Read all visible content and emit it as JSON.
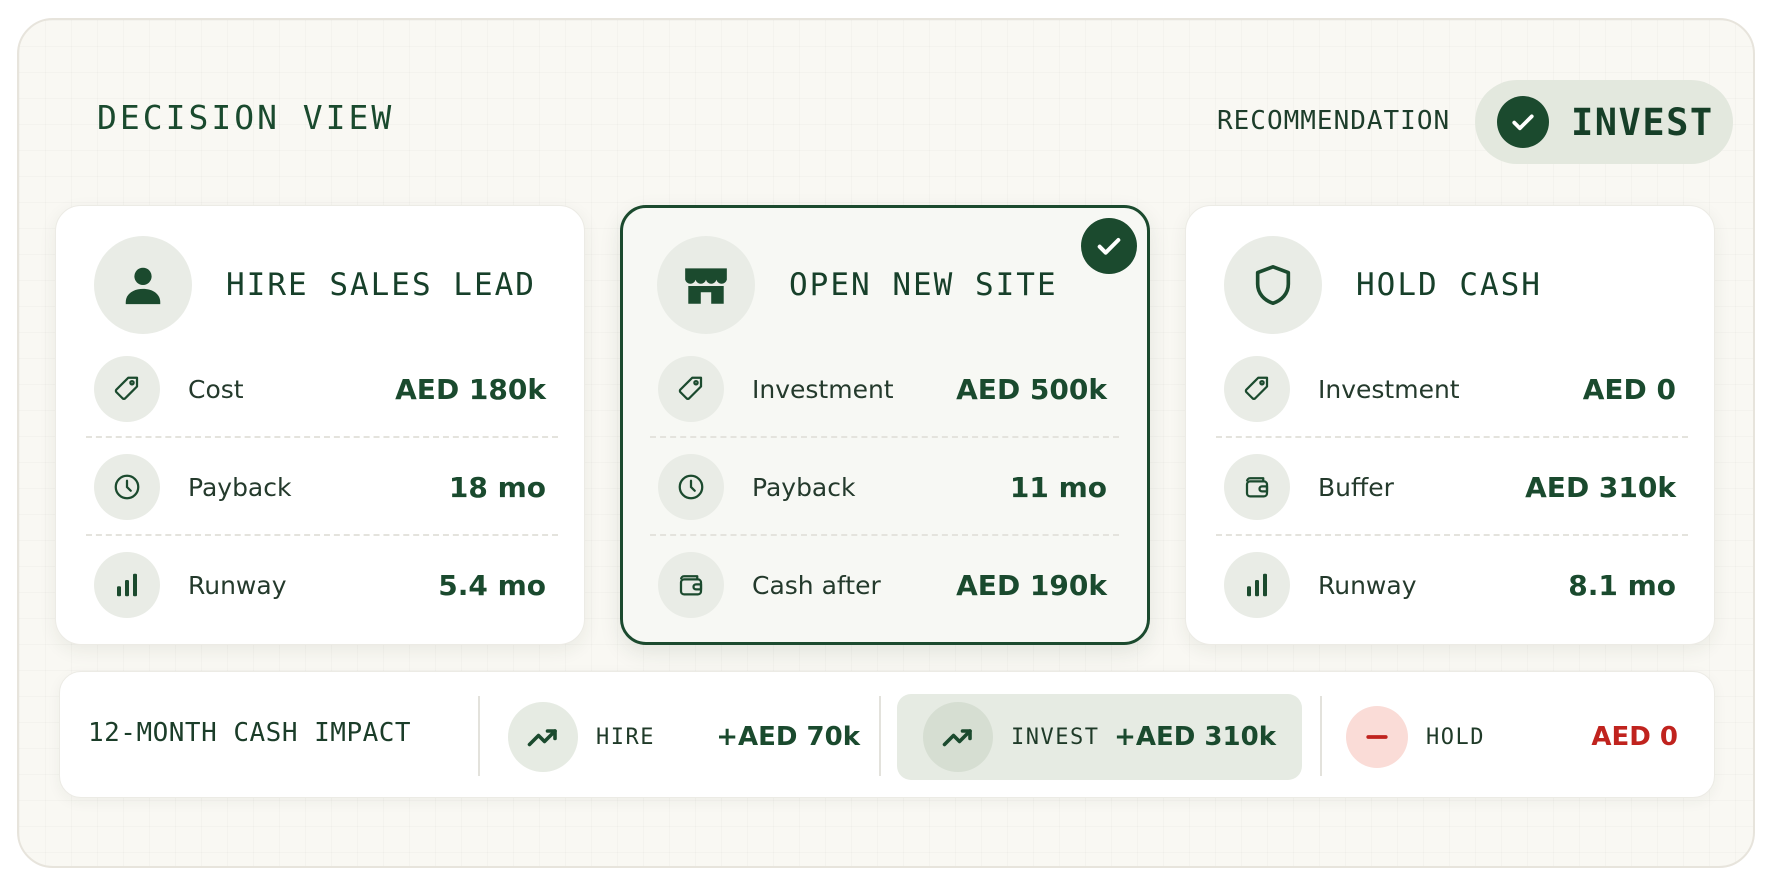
{
  "header": {
    "title": "DECISION VIEW",
    "recommendation_label": "RECOMMENDATION",
    "recommendation_value": "INVEST"
  },
  "options": [
    {
      "title": "HIRE SALES LEAD",
      "icon": "person-icon",
      "selected": false,
      "metrics": [
        {
          "icon": "tag-icon",
          "label": "Cost",
          "value": "AED 180k"
        },
        {
          "icon": "clock-icon",
          "label": "Payback",
          "value": "18 mo"
        },
        {
          "icon": "bar-chart-icon",
          "label": "Runway",
          "value": "5.4 mo"
        }
      ]
    },
    {
      "title": "OPEN NEW SITE",
      "icon": "storefront-icon",
      "selected": true,
      "metrics": [
        {
          "icon": "tag-icon",
          "label": "Investment",
          "value": "AED 500k"
        },
        {
          "icon": "clock-icon",
          "label": "Payback",
          "value": "11 mo"
        },
        {
          "icon": "wallet-icon",
          "label": "Cash after",
          "value": "AED 190k"
        }
      ]
    },
    {
      "title": "HOLD CASH",
      "icon": "shield-icon",
      "selected": false,
      "metrics": [
        {
          "icon": "tag-icon",
          "label": "Investment",
          "value": "AED 0"
        },
        {
          "icon": "wallet-icon",
          "label": "Buffer",
          "value": "AED 310k"
        },
        {
          "icon": "bar-chart-icon",
          "label": "Runway",
          "value": "8.1 mo"
        }
      ]
    }
  ],
  "impact": {
    "title": "12-MONTH CASH IMPACT",
    "items": [
      {
        "icon": "trending-up-icon",
        "label": "HIRE",
        "value": "+AED 70k",
        "highlighted": false
      },
      {
        "icon": "trending-up-icon",
        "label": "INVEST",
        "value": "+AED 310k",
        "highlighted": true
      },
      {
        "icon": "minus-icon",
        "label": "HOLD",
        "value": "AED 0",
        "highlighted": false
      }
    ]
  },
  "colors": {
    "primary": "#1b4a2e",
    "background": "#f9f8f3",
    "icon_bg": "#e9ece6",
    "negative": "#c0231e",
    "negative_bg": "#fadcd7"
  }
}
